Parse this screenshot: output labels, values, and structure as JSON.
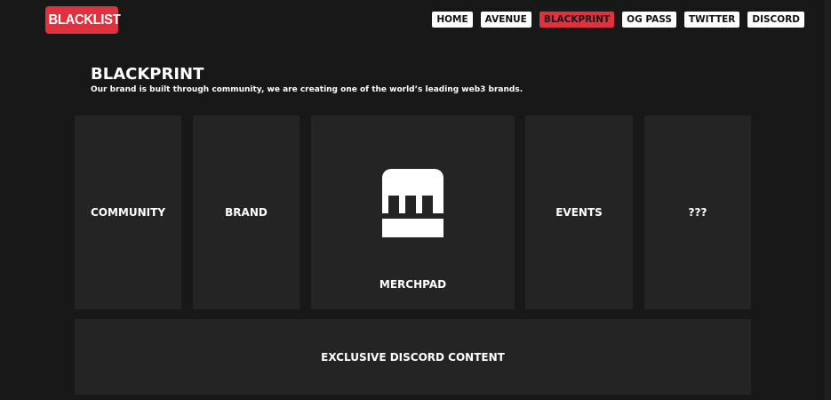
{
  "logo": {
    "text": "BLACKLIST",
    "color": "#e0313f"
  },
  "nav": {
    "items": [
      {
        "label": "HOME",
        "active": false
      },
      {
        "label": "AVENUE",
        "active": false
      },
      {
        "label": "BLACKPRINT",
        "active": true
      },
      {
        "label": "OG PASS",
        "active": false
      },
      {
        "label": "TWITTER",
        "active": false
      },
      {
        "label": "DISCORD",
        "active": false
      }
    ]
  },
  "section": {
    "title": "BLACKPRINT",
    "subtitle": "Our brand is built through community, we are creating one of the world’s leading web3 brands."
  },
  "cards": {
    "community": "COMMUNITY",
    "brand": "BRAND",
    "merchpad": "MERCHPAD",
    "events": "EVENTS",
    "unknown": "???",
    "discord": "EXCLUSIVE DISCORD CONTENT"
  },
  "colors": {
    "background": "#181818",
    "card": "#242424",
    "accent": "#e0313f",
    "text": "#ffffff"
  },
  "icons": {
    "merchpad": "merchpad-logo-icon"
  }
}
